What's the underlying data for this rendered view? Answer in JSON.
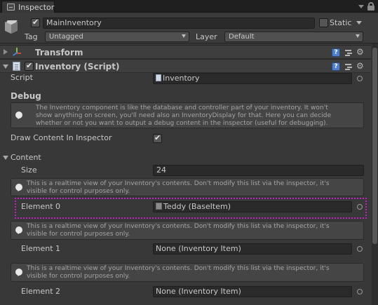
{
  "window": {
    "tab_title": "Inspector"
  },
  "header": {
    "object_name": "MainInventory",
    "active": true,
    "static_label": "Static",
    "tag_label": "Tag",
    "tag_value": "Untagged",
    "layer_label": "Layer",
    "layer_value": "Default"
  },
  "components": {
    "transform": {
      "title": "Transform"
    },
    "inventory": {
      "title": "Inventory (Script)",
      "enabled": true,
      "script_label": "Script",
      "script_value": "Inventory",
      "debug_heading": "Debug",
      "debug_help": [
        "The Inventory component is like the database and controller part of your inventory. It won't",
        "show anything on screen, you'll need also an InventoryDisplay for that. Here you can decide",
        "whether or not you want to output a debug content in the inspector (useful for debugging)."
      ],
      "draw_content_label": "Draw Content In Inspector",
      "draw_content_value": true,
      "content_label": "Content",
      "size_label": "Size",
      "size_value": "24",
      "element_help": [
        "This is a realtime view of your Inventory's contents. Don't modify this list via the inspector, it's",
        "visible for control purposes only."
      ],
      "elements": [
        {
          "label": "Element 0",
          "value": "Teddy (BaseItem)"
        },
        {
          "label": "Element 1",
          "value": "None (Inventory Item)"
        },
        {
          "label": "Element 2",
          "value": "None (Inventory Item)"
        }
      ]
    }
  },
  "colors": {
    "selection_outline": "#c020c0",
    "panel_bg": "#383838"
  }
}
